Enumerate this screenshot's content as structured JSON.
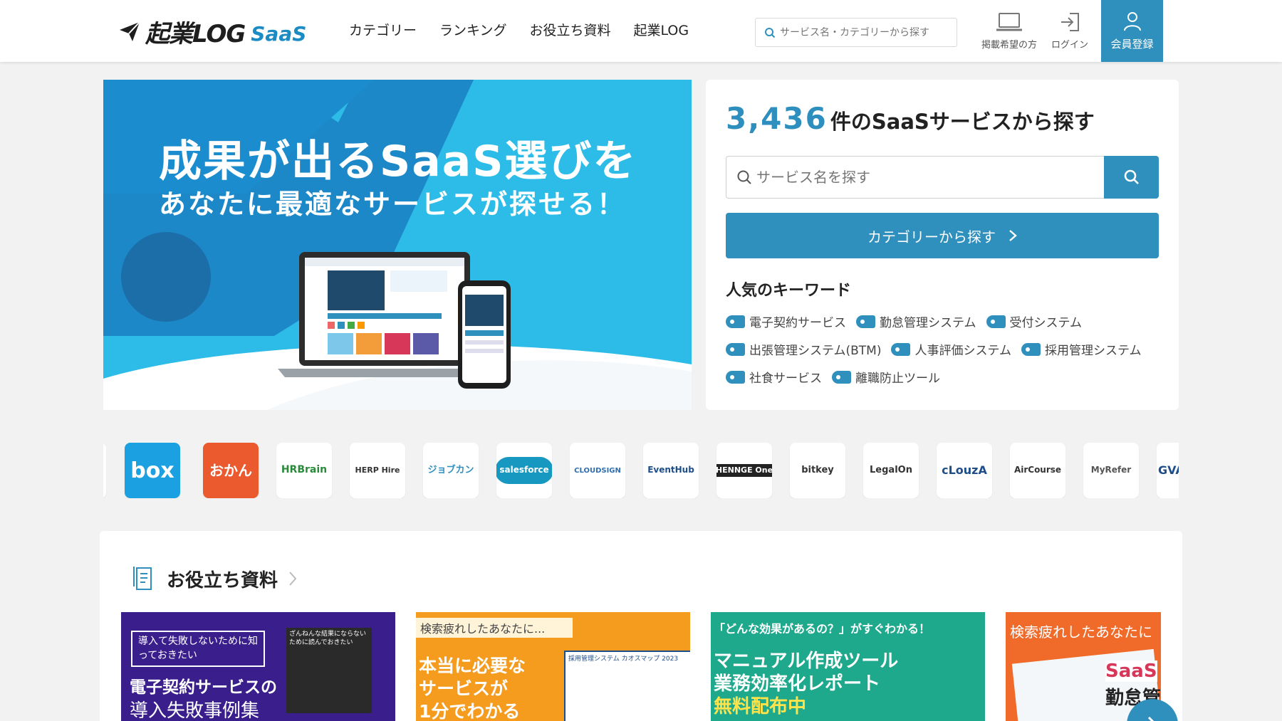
{
  "header": {
    "logo_text": "起業LOG",
    "logo_saas": "SaaS",
    "nav": [
      "カテゴリー",
      "ランキング",
      "お役立ち資料",
      "起業LOG"
    ],
    "search_placeholder": "サービス名・カテゴリーから探す",
    "post_label": "掲載希望の方",
    "login_label": "ログイン",
    "register_label": "会員登録"
  },
  "banner": {
    "title": "成果が出るSaaS選びを",
    "subtitle": "あなたに最適なサービスが探せる！"
  },
  "search_panel": {
    "count": "3,436",
    "title_suffix": "件のSaaSサービスから探す",
    "placeholder": "サービス名を探す",
    "category_button": "カテゴリーから探す",
    "keywords_title": "人気のキーワード",
    "keywords": [
      "電子契約サービス",
      "勤怠管理システム",
      "受付システム",
      "出張管理システム(BTM)",
      "人事評価システム",
      "採用管理システム",
      "社食サービス",
      "離職防止ツール"
    ]
  },
  "logos": [
    "box",
    "おかん",
    "HRBrain",
    "HERP Hire",
    "ジョブカン",
    "salesforce",
    "CLOUDSIGN",
    "EventHub",
    "HENNGE One",
    "bitkey",
    "LegalOn",
    "cLouzA",
    "AirCourse",
    "MyRefer",
    "GVA"
  ],
  "resources": {
    "title": "お役立ち資料",
    "cards": [
      {
        "label": "導入て失敗しないために知っておきたい",
        "title": "電子契約サービスの",
        "title2": "導入失敗事例集",
        "note": "ざんねんな結果にならないために読んでおきたい"
      },
      {
        "label": "検索疲れしたあなたに...",
        "title": "本当に必要な",
        "title2": "サービスが",
        "title3": "1分でわかる",
        "note": "採用管理システム カオスマップ 2023"
      },
      {
        "label": "「どんな効果があるの？」がすぐわかる！",
        "title": "マニュアル作成ツール",
        "title2": "業務効率化レポート",
        "title3": "無料配布中"
      },
      {
        "label": "検索疲れしたあなたに",
        "title": "SaaS",
        "title2": "勤怠管"
      }
    ]
  },
  "colors": {
    "accent": "#2f8fbd",
    "banner_bg": "#2dbce8",
    "banner_dark": "#1b7fc2"
  }
}
